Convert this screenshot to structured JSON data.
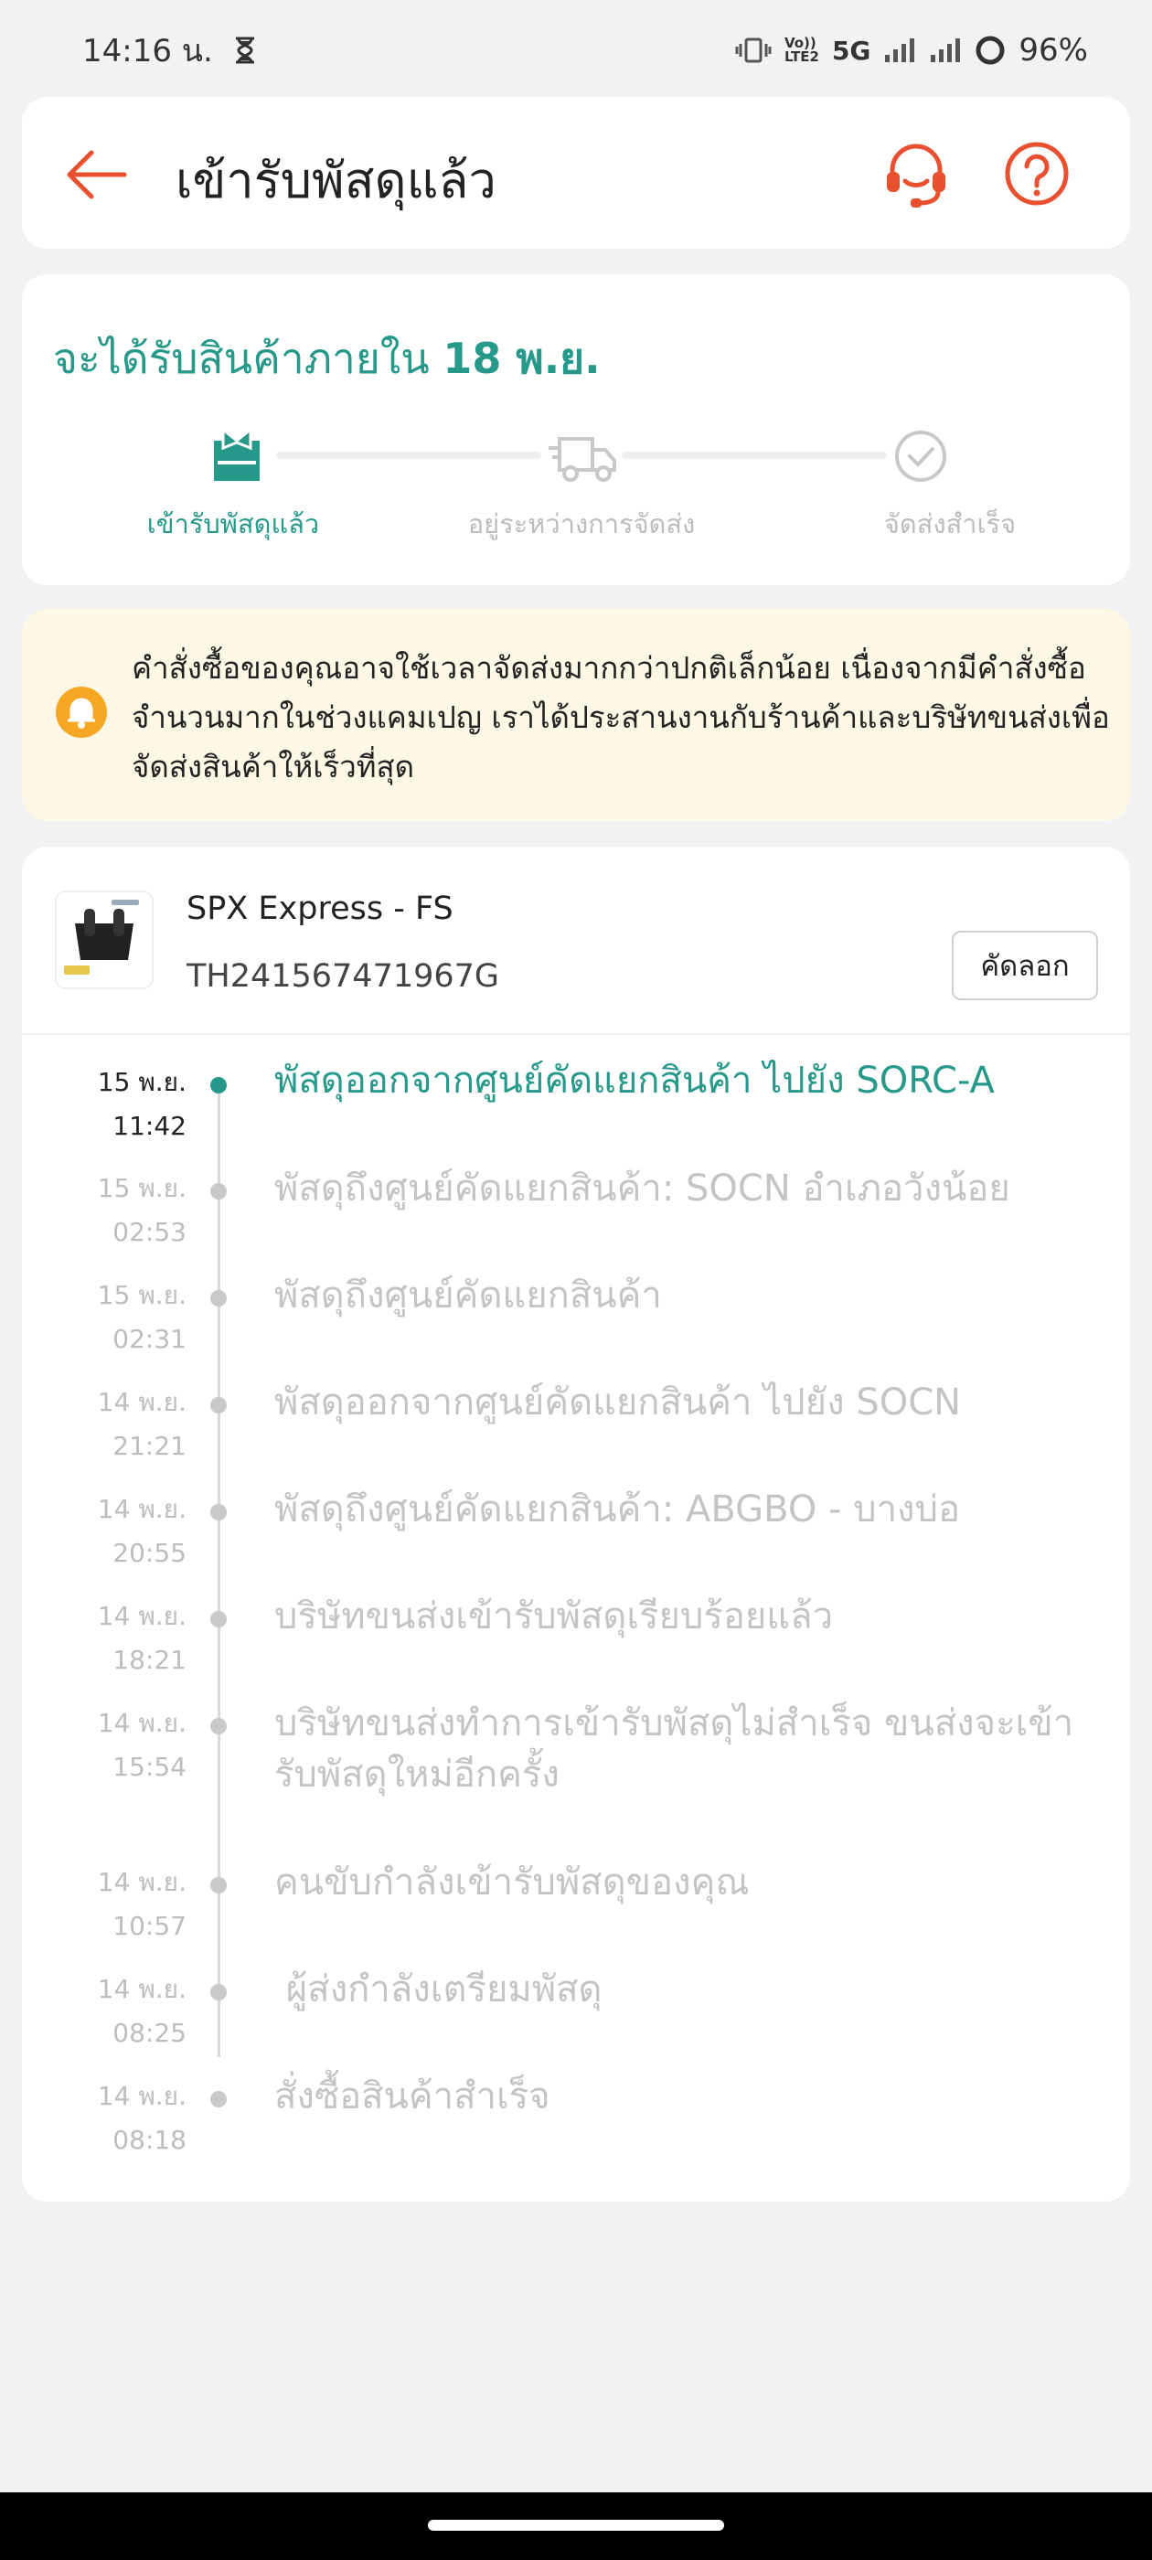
{
  "status_bar": {
    "time": "14:16 น.",
    "network_top": "Vo))",
    "network_bottom": "LTE2",
    "network_type": "5G",
    "battery": "96%"
  },
  "header": {
    "title": "เข้ารับพัสดุแล้ว",
    "accent_color": "#e8502f"
  },
  "delivery": {
    "eta_prefix": "จะได้รับสินค้าภายใน ",
    "eta_date": "18 พ.ย.",
    "steps": [
      {
        "label": "เข้ารับพัสดุแล้ว",
        "icon": "package-box-icon",
        "active": true
      },
      {
        "label": "อยู่ระหว่างการจัดส่ง",
        "icon": "truck-icon",
        "active": false
      },
      {
        "label": "จัดส่งสำเร็จ",
        "icon": "check-circle-icon",
        "active": false
      }
    ]
  },
  "notice": {
    "icon": "bell-icon",
    "text": "คำสั่งซื้อของคุณอาจใช้เวลาจัดส่งมากกว่าปกติเล็กน้อย เนื่องจากมีคำสั่งซื้อจำนวนมากในช่วงแคมเปญ เราได้ประสานงานกับร้านค้าและบริษัทขนส่งเพื่อจัดส่งสินค้าให้เร็วที่สุด"
  },
  "shipment": {
    "carrier": "SPX Express - FS",
    "tracking_number": "TH241567471967G",
    "copy_label": "คัดลอก"
  },
  "timeline": [
    {
      "date": "15 พ.ย.",
      "time": "11:42",
      "text": "พัสดุออกจากศูนย์คัดแยกสินค้า ไปยัง SORC-A",
      "current": true
    },
    {
      "date": "15 พ.ย.",
      "time": "02:53",
      "text": "พัสดุถึงศูนย์คัดแยกสินค้า: SOCN อำเภอวังน้อย",
      "current": false
    },
    {
      "date": "15 พ.ย.",
      "time": "02:31",
      "text": "พัสดุถึงศูนย์คัดแยกสินค้า",
      "current": false
    },
    {
      "date": "14 พ.ย.",
      "time": "21:21",
      "text": "พัสดุออกจากศูนย์คัดแยกสินค้า ไปยัง SOCN",
      "current": false
    },
    {
      "date": "14 พ.ย.",
      "time": "20:55",
      "text": "พัสดุถึงศูนย์คัดแยกสินค้า: ABGBO - บางบ่อ",
      "current": false
    },
    {
      "date": "14 พ.ย.",
      "time": "18:21",
      "text": "บริษัทขนส่งเข้ารับพัสดุเรียบร้อยแล้ว",
      "current": false
    },
    {
      "date": "14 พ.ย.",
      "time": "15:54",
      "text": "บริษัทขนส่งทำการเข้ารับพัสดุไม่สำเร็จ ขนส่งจะเข้ารับพัสดุใหม่อีกครั้ง",
      "current": false
    },
    {
      "date": "14 พ.ย.",
      "time": "10:57",
      "text": "คนขับกำลังเข้ารับพัสดุของคุณ",
      "current": false
    },
    {
      "date": "14 พ.ย.",
      "time": "08:25",
      "text": " ผู้ส่งกำลังเตรียมพัสดุ",
      "current": false
    },
    {
      "date": "14 พ.ย.",
      "time": "08:18",
      "text": "สั่งซื้อสินค้าสำเร็จ",
      "current": false
    }
  ]
}
